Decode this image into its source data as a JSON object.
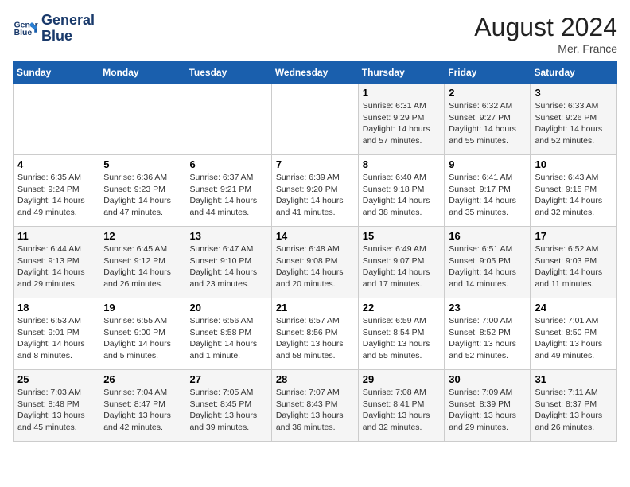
{
  "header": {
    "logo_line1": "General",
    "logo_line2": "Blue",
    "month_year": "August 2024",
    "location": "Mer, France"
  },
  "days_of_week": [
    "Sunday",
    "Monday",
    "Tuesday",
    "Wednesday",
    "Thursday",
    "Friday",
    "Saturday"
  ],
  "weeks": [
    [
      {
        "num": "",
        "detail": ""
      },
      {
        "num": "",
        "detail": ""
      },
      {
        "num": "",
        "detail": ""
      },
      {
        "num": "",
        "detail": ""
      },
      {
        "num": "1",
        "detail": "Sunrise: 6:31 AM\nSunset: 9:29 PM\nDaylight: 14 hours\nand 57 minutes."
      },
      {
        "num": "2",
        "detail": "Sunrise: 6:32 AM\nSunset: 9:27 PM\nDaylight: 14 hours\nand 55 minutes."
      },
      {
        "num": "3",
        "detail": "Sunrise: 6:33 AM\nSunset: 9:26 PM\nDaylight: 14 hours\nand 52 minutes."
      }
    ],
    [
      {
        "num": "4",
        "detail": "Sunrise: 6:35 AM\nSunset: 9:24 PM\nDaylight: 14 hours\nand 49 minutes."
      },
      {
        "num": "5",
        "detail": "Sunrise: 6:36 AM\nSunset: 9:23 PM\nDaylight: 14 hours\nand 47 minutes."
      },
      {
        "num": "6",
        "detail": "Sunrise: 6:37 AM\nSunset: 9:21 PM\nDaylight: 14 hours\nand 44 minutes."
      },
      {
        "num": "7",
        "detail": "Sunrise: 6:39 AM\nSunset: 9:20 PM\nDaylight: 14 hours\nand 41 minutes."
      },
      {
        "num": "8",
        "detail": "Sunrise: 6:40 AM\nSunset: 9:18 PM\nDaylight: 14 hours\nand 38 minutes."
      },
      {
        "num": "9",
        "detail": "Sunrise: 6:41 AM\nSunset: 9:17 PM\nDaylight: 14 hours\nand 35 minutes."
      },
      {
        "num": "10",
        "detail": "Sunrise: 6:43 AM\nSunset: 9:15 PM\nDaylight: 14 hours\nand 32 minutes."
      }
    ],
    [
      {
        "num": "11",
        "detail": "Sunrise: 6:44 AM\nSunset: 9:13 PM\nDaylight: 14 hours\nand 29 minutes."
      },
      {
        "num": "12",
        "detail": "Sunrise: 6:45 AM\nSunset: 9:12 PM\nDaylight: 14 hours\nand 26 minutes."
      },
      {
        "num": "13",
        "detail": "Sunrise: 6:47 AM\nSunset: 9:10 PM\nDaylight: 14 hours\nand 23 minutes."
      },
      {
        "num": "14",
        "detail": "Sunrise: 6:48 AM\nSunset: 9:08 PM\nDaylight: 14 hours\nand 20 minutes."
      },
      {
        "num": "15",
        "detail": "Sunrise: 6:49 AM\nSunset: 9:07 PM\nDaylight: 14 hours\nand 17 minutes."
      },
      {
        "num": "16",
        "detail": "Sunrise: 6:51 AM\nSunset: 9:05 PM\nDaylight: 14 hours\nand 14 minutes."
      },
      {
        "num": "17",
        "detail": "Sunrise: 6:52 AM\nSunset: 9:03 PM\nDaylight: 14 hours\nand 11 minutes."
      }
    ],
    [
      {
        "num": "18",
        "detail": "Sunrise: 6:53 AM\nSunset: 9:01 PM\nDaylight: 14 hours\nand 8 minutes."
      },
      {
        "num": "19",
        "detail": "Sunrise: 6:55 AM\nSunset: 9:00 PM\nDaylight: 14 hours\nand 5 minutes."
      },
      {
        "num": "20",
        "detail": "Sunrise: 6:56 AM\nSunset: 8:58 PM\nDaylight: 14 hours\nand 1 minute."
      },
      {
        "num": "21",
        "detail": "Sunrise: 6:57 AM\nSunset: 8:56 PM\nDaylight: 13 hours\nand 58 minutes."
      },
      {
        "num": "22",
        "detail": "Sunrise: 6:59 AM\nSunset: 8:54 PM\nDaylight: 13 hours\nand 55 minutes."
      },
      {
        "num": "23",
        "detail": "Sunrise: 7:00 AM\nSunset: 8:52 PM\nDaylight: 13 hours\nand 52 minutes."
      },
      {
        "num": "24",
        "detail": "Sunrise: 7:01 AM\nSunset: 8:50 PM\nDaylight: 13 hours\nand 49 minutes."
      }
    ],
    [
      {
        "num": "25",
        "detail": "Sunrise: 7:03 AM\nSunset: 8:48 PM\nDaylight: 13 hours\nand 45 minutes."
      },
      {
        "num": "26",
        "detail": "Sunrise: 7:04 AM\nSunset: 8:47 PM\nDaylight: 13 hours\nand 42 minutes."
      },
      {
        "num": "27",
        "detail": "Sunrise: 7:05 AM\nSunset: 8:45 PM\nDaylight: 13 hours\nand 39 minutes."
      },
      {
        "num": "28",
        "detail": "Sunrise: 7:07 AM\nSunset: 8:43 PM\nDaylight: 13 hours\nand 36 minutes."
      },
      {
        "num": "29",
        "detail": "Sunrise: 7:08 AM\nSunset: 8:41 PM\nDaylight: 13 hours\nand 32 minutes."
      },
      {
        "num": "30",
        "detail": "Sunrise: 7:09 AM\nSunset: 8:39 PM\nDaylight: 13 hours\nand 29 minutes."
      },
      {
        "num": "31",
        "detail": "Sunrise: 7:11 AM\nSunset: 8:37 PM\nDaylight: 13 hours\nand 26 minutes."
      }
    ]
  ]
}
